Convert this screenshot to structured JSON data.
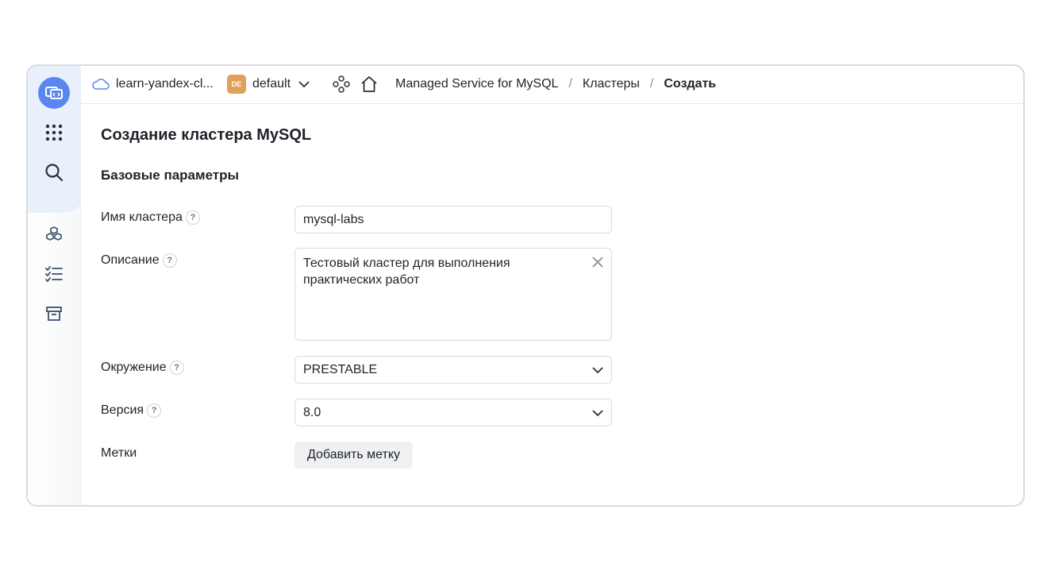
{
  "header": {
    "cloud_name": "learn-yandex-cl...",
    "folder_badge": "DE",
    "folder_name": "default",
    "breadcrumbs": [
      "Managed Service for MySQL",
      "Кластеры",
      "Создать"
    ],
    "separator": "/"
  },
  "sidebar": {
    "icons": [
      "console-logo-icon",
      "apps-grid-icon",
      "search-icon",
      "cubes-icon",
      "checklist-icon",
      "archive-icon"
    ]
  },
  "page": {
    "title": "Создание кластера MySQL",
    "section_title": "Базовые параметры"
  },
  "form": {
    "help_glyph": "?",
    "cluster_name": {
      "label": "Имя кластера",
      "value": "mysql-labs"
    },
    "description": {
      "label": "Описание",
      "value": "Тестовый кластер для выполнения практических работ"
    },
    "environment": {
      "label": "Окружение",
      "value": "PRESTABLE"
    },
    "version": {
      "label": "Версия",
      "value": "8.0"
    },
    "labels": {
      "label": "Метки",
      "add_button": "Добавить метку"
    }
  },
  "colors": {
    "accent": "#5b86f0",
    "folder_badge": "#e0a05a",
    "border": "#d9dbdf"
  }
}
